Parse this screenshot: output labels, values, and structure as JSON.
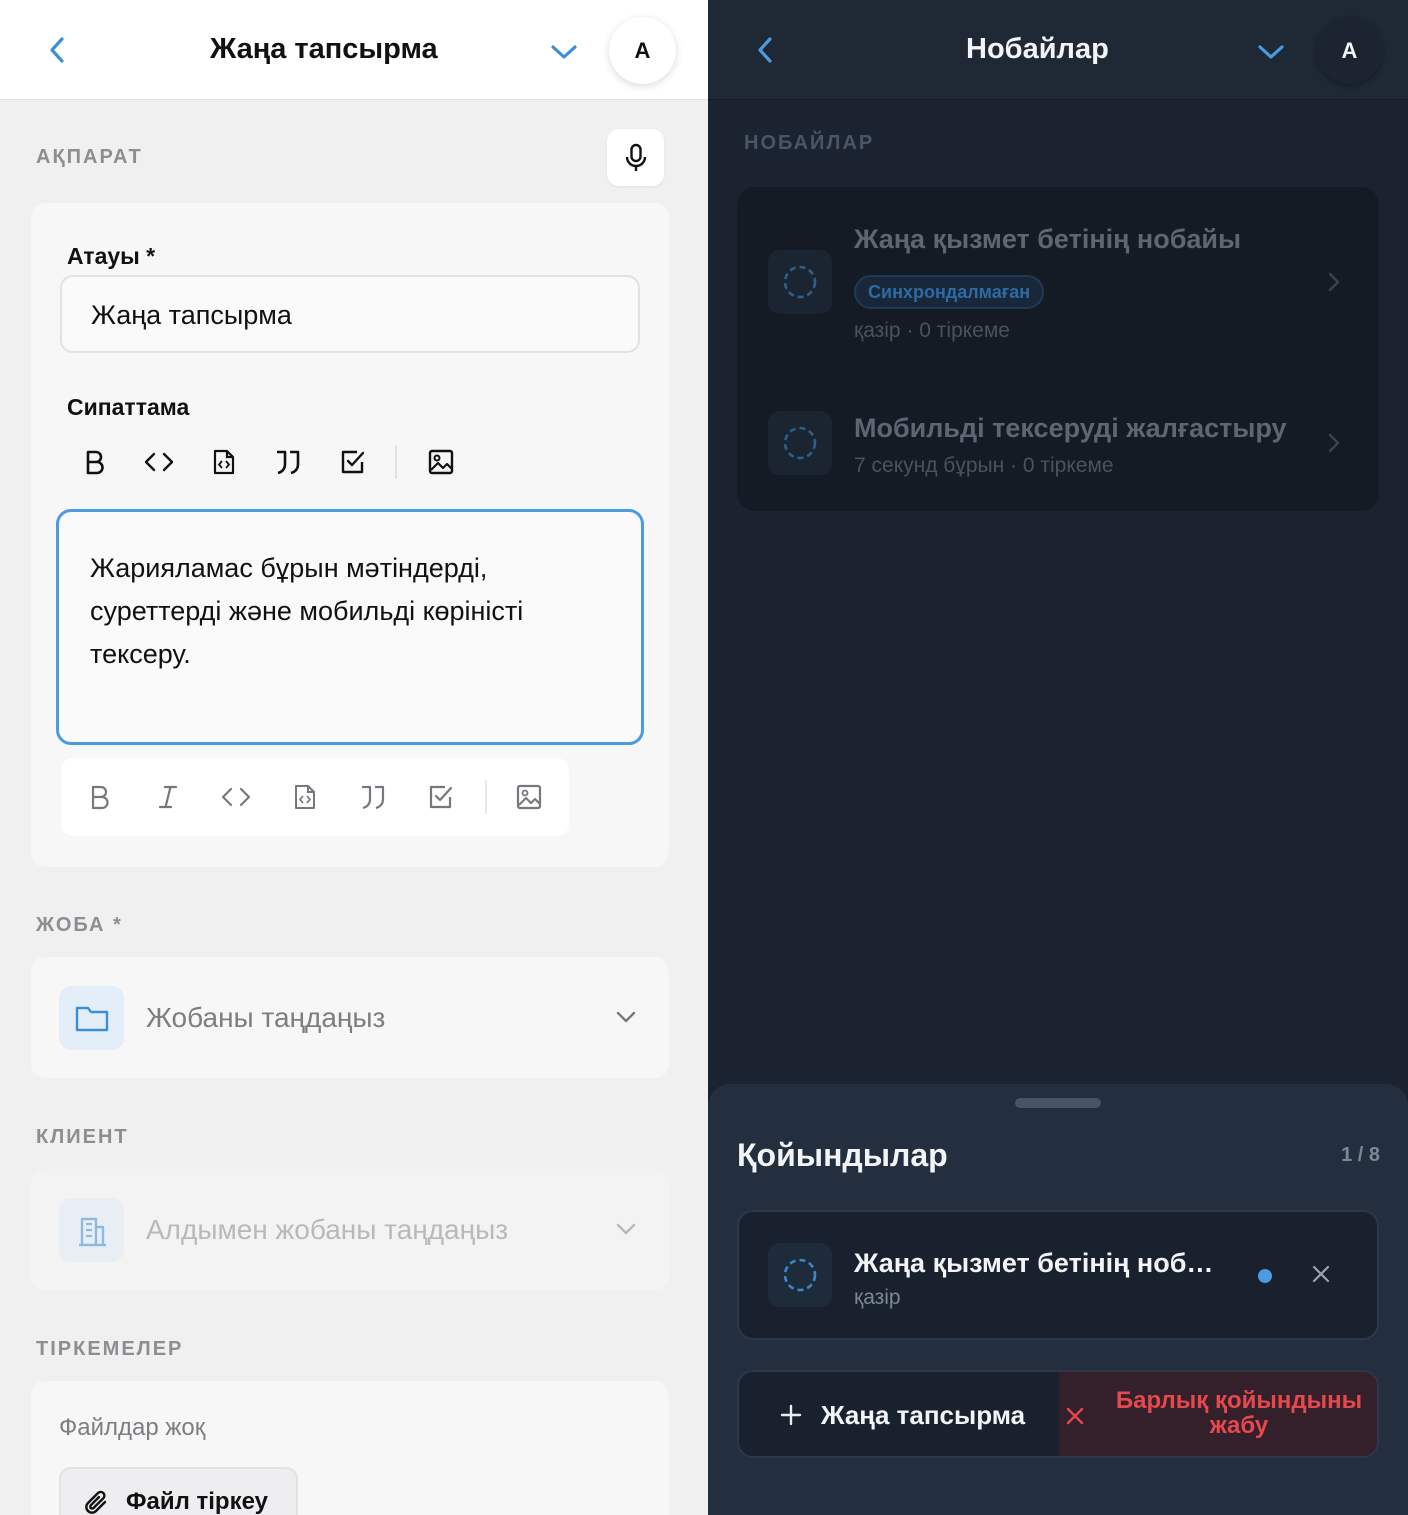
{
  "left": {
    "header": {
      "title": "Жаңа тапсырма",
      "avatar": "A"
    },
    "info": {
      "section_label": "АҚПАРАТ",
      "title_label": "Атауы *",
      "title_value": "Жаңа тапсырма",
      "description_label": "Сипаттама",
      "description_text": "Жарияламас бұрын мәтіндерді, суреттерді және мобильді көріністі тексеру."
    },
    "project": {
      "section_label": "ЖОБА *",
      "placeholder": "Жобаны таңдаңыз"
    },
    "client": {
      "section_label": "КЛИЕНТ",
      "placeholder": "Алдымен жобаны таңдаңыз"
    },
    "attachments": {
      "section_label": "ТІРКЕМЕЛЕР",
      "empty_text": "Файлдар жоқ",
      "attach_button": "Файл тіркеу"
    },
    "accent_color": "#3b8fd6"
  },
  "right": {
    "header": {
      "title": "Нобайлар",
      "avatar": "A"
    },
    "section_label": "НОБАЙЛАР",
    "drafts": [
      {
        "title": "Жаңа қызмет бетінің нобайы",
        "badge": "Синхрондалмаған",
        "meta": "қазір · 0 тіркеме"
      },
      {
        "title": "Мобильді тексеруді жалғастыру",
        "meta": "7 секунд бұрын · 0 тіркеме"
      }
    ],
    "sheet": {
      "title": "Қойындылар",
      "counter": "1 / 8",
      "tab": {
        "title": "Жаңа қызмет бетінің нобайы",
        "meta": "қазір"
      },
      "new_task_button": "Жаңа тапсырма",
      "close_all_button": "Барлық қойындыны жабу"
    },
    "danger_color": "#e5484d"
  }
}
